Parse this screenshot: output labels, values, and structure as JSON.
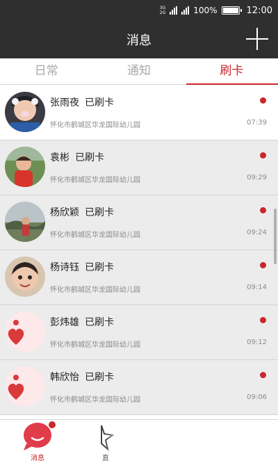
{
  "status_bar": {
    "network_top": "3G",
    "network_bottom": "2G",
    "battery": "100%",
    "time": "12:00"
  },
  "header": {
    "title": "消息",
    "add_icon": "plus-icon"
  },
  "tabs": [
    {
      "label": "日常",
      "active": false
    },
    {
      "label": "通知",
      "active": false
    },
    {
      "label": "刷卡",
      "active": true
    }
  ],
  "messages": [
    {
      "name": "张雨夜",
      "status": "已刷卡",
      "school": "怀化市鹤城区华龙国际幼儿园",
      "time": "07:39",
      "avatar": "photo-child-avatar"
    },
    {
      "name": "袁彬",
      "status": "已刷卡",
      "school": "怀化市鹤城区华龙国际幼儿园",
      "time": "09:29",
      "avatar": "photo-child-avatar"
    },
    {
      "name": "杨欣颖",
      "status": "已刷卡",
      "school": "怀化市鹤城区华龙国际幼儿园",
      "time": "09:24",
      "avatar": "photo-child-avatar"
    },
    {
      "name": "杨诗钰",
      "status": "已刷卡",
      "school": "怀化市鹤城区华龙国际幼儿园",
      "time": "09:14",
      "avatar": "photo-child-avatar"
    },
    {
      "name": "彭炜雄",
      "status": "已刷卡",
      "school": "怀化市鹤城区华龙国际幼儿园",
      "time": "09:12",
      "avatar": "default-heart-avatar"
    },
    {
      "name": "韩欣怡",
      "status": "已刷卡",
      "school": "怀化市鹤城区华龙国际幼儿园",
      "time": "09:06",
      "avatar": "default-heart-avatar"
    }
  ],
  "bottom_nav": {
    "items": [
      {
        "label": "消息",
        "icon": "chat-bubble-icon",
        "active": true
      },
      {
        "label": "直",
        "icon": "star-icon",
        "active": false
      }
    ]
  },
  "colors": {
    "accent": "#c9262c",
    "header_bg": "#2f2f2f"
  }
}
